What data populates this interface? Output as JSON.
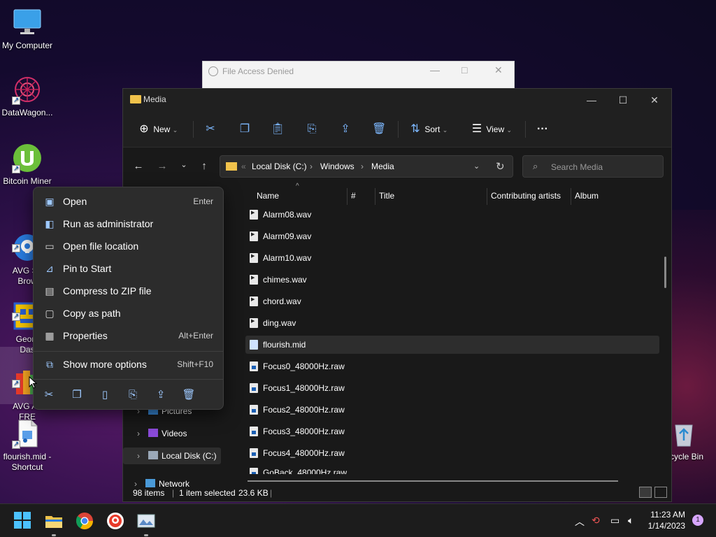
{
  "desktop": {
    "icons": [
      {
        "label": "My Computer",
        "icon": "monitor-icon"
      },
      {
        "label": "DataWagon...",
        "icon": "datawagon-icon"
      },
      {
        "label": "Bitcoin Miner",
        "icon": "utorrent-icon"
      },
      {
        "label": "AVG Se\nBrow",
        "icon": "avg-browser-icon"
      },
      {
        "label": "Geom\nDas",
        "icon": "geometry-dash-icon"
      },
      {
        "label": "AVG An\nFRE",
        "icon": "avg-antivirus-icon"
      },
      {
        "label": "flourish.mid - Shortcut",
        "icon": "midi-file-icon"
      },
      {
        "label": "cycle Bin",
        "icon": "recycle-bin-icon"
      }
    ]
  },
  "background_dialog": {
    "title": "File Access Denied"
  },
  "explorer": {
    "title": "Media",
    "toolbar": {
      "new_label": "New",
      "sort_label": "Sort",
      "view_label": "View",
      "more_label": "···"
    },
    "address": {
      "crumbs": [
        "Local Disk (C:)",
        "Windows",
        "Media"
      ],
      "search_placeholder": "Search Media"
    },
    "columns": [
      "Name",
      "#",
      "Title",
      "Contributing artists",
      "Album"
    ],
    "files": [
      {
        "name": "Alarm08.wav",
        "type": "wav"
      },
      {
        "name": "Alarm09.wav",
        "type": "wav"
      },
      {
        "name": "Alarm10.wav",
        "type": "wav"
      },
      {
        "name": "chimes.wav",
        "type": "wav"
      },
      {
        "name": "chord.wav",
        "type": "wav"
      },
      {
        "name": "ding.wav",
        "type": "wav"
      },
      {
        "name": "flourish.mid",
        "type": "mid",
        "selected": true
      },
      {
        "name": "Focus0_48000Hz.raw",
        "type": "raw"
      },
      {
        "name": "Focus1_48000Hz.raw",
        "type": "raw"
      },
      {
        "name": "Focus2_48000Hz.raw",
        "type": "raw"
      },
      {
        "name": "Focus3_48000Hz.raw",
        "type": "raw"
      },
      {
        "name": "Focus4_48000Hz.raw",
        "type": "raw"
      },
      {
        "name": "GoBack_48000Hz.raw",
        "type": "raw"
      }
    ],
    "nav": [
      {
        "label": "Pictures",
        "icon": "pictures-icon"
      },
      {
        "label": "Videos",
        "icon": "videos-icon"
      },
      {
        "label": "Local Disk (C:)",
        "icon": "drive-icon",
        "selected": true
      },
      {
        "label": "Network",
        "icon": "network-icon"
      }
    ],
    "status": {
      "items": "98 items",
      "selection": "1 item selected",
      "size": "23.6 KB"
    }
  },
  "context_menu": {
    "items": [
      {
        "label": "Open",
        "shortcut": "Enter",
        "icon": "open-icon"
      },
      {
        "label": "Run as administrator",
        "shortcut": "",
        "icon": "shield-icon"
      },
      {
        "label": "Open file location",
        "shortcut": "",
        "icon": "folder-icon"
      },
      {
        "label": "Pin to Start",
        "shortcut": "",
        "icon": "pin-icon"
      },
      {
        "label": "Compress to ZIP file",
        "shortcut": "",
        "icon": "zip-icon"
      },
      {
        "label": "Copy as path",
        "shortcut": "",
        "icon": "copy-path-icon"
      },
      {
        "label": "Properties",
        "shortcut": "Alt+Enter",
        "icon": "properties-icon"
      },
      {
        "label": "Show more options",
        "shortcut": "Shift+F10",
        "icon": "more-options-icon"
      }
    ],
    "actions": [
      "cut-icon",
      "copy-icon",
      "paste-icon",
      "rename-icon",
      "share-icon",
      "delete-icon"
    ]
  },
  "taskbar": {
    "apps": [
      "start-icon",
      "file-explorer-icon",
      "chrome-icon",
      "avg-browser-icon",
      "image-viewer-icon"
    ],
    "time": "11:23 AM",
    "date": "1/14/2023",
    "notification_count": "1"
  }
}
